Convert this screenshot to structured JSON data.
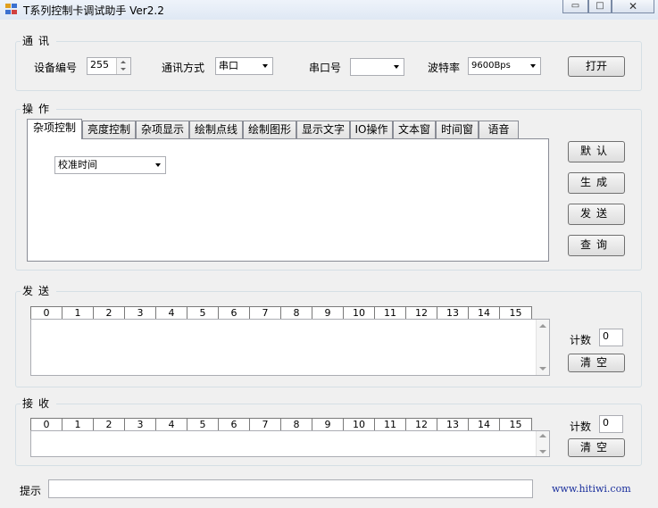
{
  "window": {
    "title": "T系列控制卡调试助手 Ver2.2"
  },
  "comm": {
    "group_title": "通讯",
    "device_no_label": "设备编号",
    "device_no_value": "255",
    "mode_label": "通讯方式",
    "mode_value": "串口",
    "port_label": "串口号",
    "port_value": "",
    "baud_label": "波特率",
    "baud_value": "9600Bps",
    "open_label": "打开"
  },
  "operate": {
    "group_title": "操作",
    "tabs": [
      "杂项控制",
      "亮度控制",
      "杂项显示",
      "绘制点线",
      "绘制图形",
      "显示文字",
      "IO操作",
      "文本窗",
      "时间窗",
      "语音"
    ],
    "active_tab": 0,
    "command_value": "校准时间",
    "buttons": {
      "default": "默认",
      "generate": "生成",
      "send": "发送",
      "query": "查询"
    }
  },
  "send": {
    "group_title": "发送",
    "byte_index": [
      "0",
      "1",
      "2",
      "3",
      "4",
      "5",
      "6",
      "7",
      "8",
      "9",
      "10",
      "11",
      "12",
      "13",
      "14",
      "15"
    ],
    "count_label": "计数",
    "count_value": "0",
    "clear_label": "清空"
  },
  "receive": {
    "group_title": "接收",
    "byte_index": [
      "0",
      "1",
      "2",
      "3",
      "4",
      "5",
      "6",
      "7",
      "8",
      "9",
      "10",
      "11",
      "12",
      "13",
      "14",
      "15"
    ],
    "count_label": "计数",
    "count_value": "0",
    "clear_label": "清空"
  },
  "footer": {
    "hint_label": "提示",
    "hint_value": "",
    "website": "www.hitiwi.com"
  },
  "colors": {
    "website": "#1a2f9c",
    "group_border": "#d5dfe5",
    "background": "#f0f0f0"
  }
}
